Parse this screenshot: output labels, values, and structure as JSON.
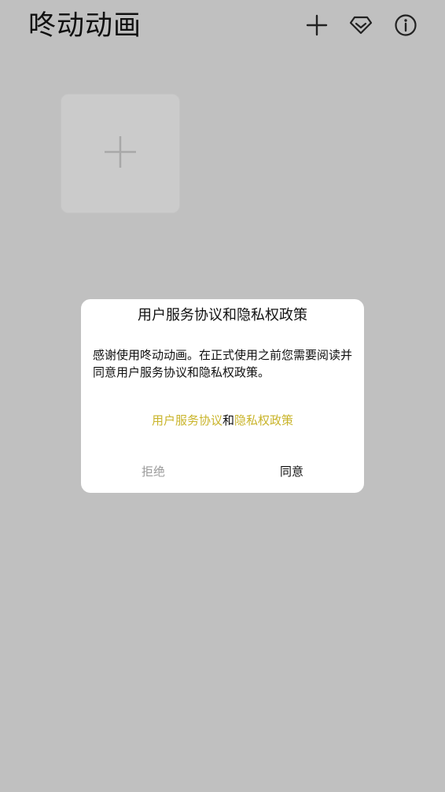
{
  "header": {
    "title": "咚动动画",
    "icons": [
      "add-icon",
      "diamond-icon",
      "info-icon"
    ]
  },
  "grid": {
    "add_tile_icon": "plus-icon"
  },
  "dialog": {
    "title": "用户服务协议和隐私权政策",
    "body": "感谢使用咚动动画。在正式使用之前您需要阅读并同意用户服务协议和隐私权政策。",
    "link_user_agreement": "用户服务协议",
    "link_connector": "和",
    "link_privacy_policy": "隐私权政策",
    "refuse_label": "拒绝",
    "agree_label": "同意"
  },
  "colors": {
    "overlay_background": "#c0c0c0",
    "link": "#c9b42a",
    "refuse": "#9a9a9a"
  }
}
